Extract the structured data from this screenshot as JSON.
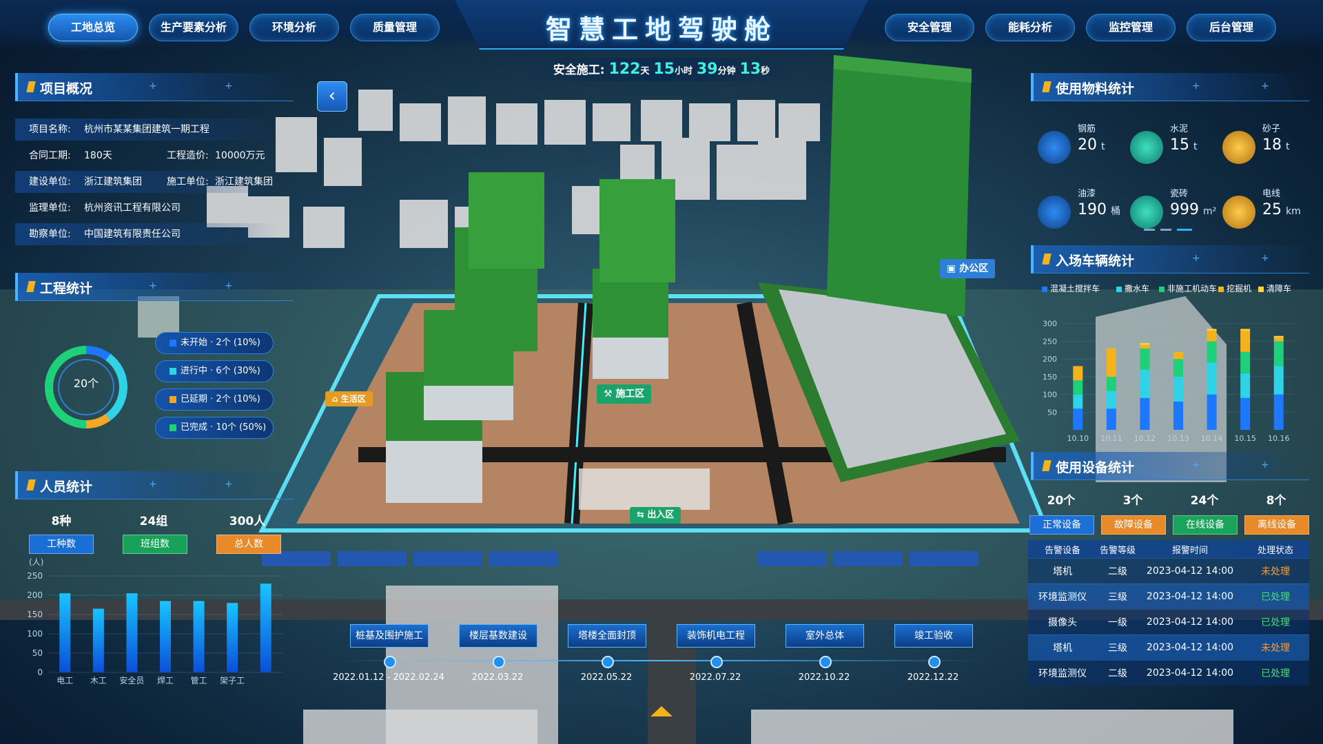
{
  "header": {
    "title": "智慧工地驾驶舱",
    "nav_left": [
      "工地总览",
      "生产要素分析",
      "环境分析",
      "质量管理"
    ],
    "nav_right": [
      "安全管理",
      "能耗分析",
      "监控管理",
      "后台管理"
    ],
    "active_tab": "工地总览"
  },
  "safety_timer": {
    "label": "安全施工:",
    "days": "122",
    "days_unit": "天",
    "hours": "15",
    "hours_unit": "小时",
    "minutes": "39",
    "minutes_unit": "分钟",
    "seconds": "13",
    "seconds_unit": "秒"
  },
  "project_overview": {
    "title": "项目概况",
    "name_label": "项目名称:",
    "name": "杭州市某某集团建筑一期工程",
    "period_label": "合同工期:",
    "period": "180天",
    "cost_label": "工程造价:",
    "cost": "10000万元",
    "builder_label": "建设单位:",
    "builder": "浙江建筑集团",
    "constructor_label": "施工单位:",
    "constructor": "浙江建筑集团",
    "supervisor_label": "监理单位:",
    "supervisor": "杭州资讯工程有限公司",
    "surveyor_label": "勘察单位:",
    "surveyor": "中国建筑有限责任公司"
  },
  "engineering_stats": {
    "title": "工程统计",
    "total": "20个",
    "items": [
      {
        "label": "未开始",
        "text": "2个 (10%)",
        "color": "#1e78ff",
        "value": 10
      },
      {
        "label": "进行中",
        "text": "6个 (30%)",
        "color": "#2fd3e8",
        "value": 30
      },
      {
        "label": "已延期",
        "text": "2个 (10%)",
        "color": "#f5a623",
        "value": 10
      },
      {
        "label": "已完成",
        "text": "10个 (50%)",
        "color": "#1fd07a",
        "value": 50
      }
    ]
  },
  "personnel_stats": {
    "title": "人员统计",
    "types_value": "8种",
    "types_label": "工种数",
    "groups_value": "24组",
    "groups_label": "班组数",
    "people_value": "300人",
    "people_label": "总人数",
    "y_unit": "(人)"
  },
  "material_stats": {
    "title": "使用物料统计",
    "items": [
      {
        "name": "钢筋",
        "value": "20",
        "unit": "t",
        "icon": "steel-icon"
      },
      {
        "name": "水泥",
        "value": "15",
        "unit": "t",
        "icon": "cement-icon"
      },
      {
        "name": "砂子",
        "value": "18",
        "unit": "t",
        "icon": "sand-icon"
      },
      {
        "name": "油漆",
        "value": "190",
        "unit": "桶",
        "icon": "paint-icon"
      },
      {
        "name": "瓷砖",
        "value": "999",
        "unit": "m²",
        "icon": "tile-icon"
      },
      {
        "name": "电线",
        "value": "25",
        "unit": "km",
        "icon": "wire-icon"
      }
    ]
  },
  "vehicle_stats": {
    "title": "入场车辆统计",
    "legend": [
      "混凝土搅拌车",
      "撒水车",
      "非施工机动车",
      "挖掘机",
      "清障车"
    ]
  },
  "equipment_stats": {
    "title": "使用设备统计",
    "cards": [
      {
        "value": "20个",
        "label": "正常设备",
        "color": "#1b6fd6"
      },
      {
        "value": "3个",
        "label": "故障设备",
        "color": "#e8892a"
      },
      {
        "value": "24个",
        "label": "在线设备",
        "color": "#1aa35a"
      },
      {
        "value": "8个",
        "label": "离线设备",
        "color": "#e8892a"
      }
    ],
    "table_headers": [
      "告警设备",
      "告警等级",
      "报警时间",
      "处理状态"
    ],
    "rows": [
      {
        "device": "塔机",
        "level": "二级",
        "time": "2023-04-12 14:00",
        "status": "未处理"
      },
      {
        "device": "环境监测仪",
        "level": "三级",
        "time": "2023-04-12 14:00",
        "status": "已处理"
      },
      {
        "device": "摄像头",
        "level": "一级",
        "time": "2023-04-12 14:00",
        "status": "已处理"
      },
      {
        "device": "塔机",
        "level": "三级",
        "time": "2023-04-12 14:00",
        "status": "未处理"
      },
      {
        "device": "环境监测仪",
        "level": "二级",
        "time": "2023-04-12 14:00",
        "status": "已处理"
      }
    ]
  },
  "zones": {
    "office": "办公区",
    "living": "生活区",
    "construction": "施工区",
    "entrance": "出入区"
  },
  "timeline": [
    {
      "phase": "桩基及围护施工",
      "date": "2022.01.12 - 2022.02.24"
    },
    {
      "phase": "楼层基数建设",
      "date": "2022.03.22"
    },
    {
      "phase": "塔楼全面封顶",
      "date": "2022.05.22"
    },
    {
      "phase": "装饰机电工程",
      "date": "2022.07.22"
    },
    {
      "phase": "室外总体",
      "date": "2022.10.22"
    },
    {
      "phase": "竣工验收",
      "date": "2022.12.22"
    }
  ],
  "chart_data": [
    {
      "type": "bar",
      "title": "",
      "ylabel": "(人)",
      "categories": [
        "电工",
        "木工",
        "安全员",
        "焊工",
        "管工",
        "架子工",
        ""
      ],
      "values": [
        205,
        165,
        205,
        185,
        185,
        180,
        230
      ],
      "yticks": [
        0,
        50,
        100,
        150,
        200,
        250
      ],
      "ylim": [
        0,
        250
      ],
      "color": "#19c4ff"
    },
    {
      "type": "bar",
      "stacked": true,
      "title": "",
      "categories": [
        "10.10",
        "10.11",
        "10.12",
        "10.13",
        "10.14",
        "10.15",
        "10.16"
      ],
      "yticks": [
        50,
        100,
        150,
        200,
        250,
        300
      ],
      "ylim": [
        0,
        350
      ],
      "series": [
        {
          "name": "混凝土搅拌车",
          "color": "#1e78ff",
          "values": [
            60,
            60,
            90,
            80,
            100,
            90,
            100
          ]
        },
        {
          "name": "撒水车",
          "color": "#2fd3e8",
          "values": [
            40,
            50,
            80,
            70,
            90,
            70,
            80
          ]
        },
        {
          "name": "非施工机动车",
          "color": "#1fd07a",
          "values": [
            40,
            40,
            60,
            50,
            60,
            60,
            70
          ]
        },
        {
          "name": "挖掘机",
          "color": "#f5b31b",
          "values": [
            40,
            80,
            10,
            20,
            30,
            60,
            10
          ]
        },
        {
          "name": "清障车",
          "color": "#ffd23f",
          "values": [
            0,
            0,
            5,
            0,
            5,
            5,
            5
          ]
        }
      ]
    }
  ]
}
